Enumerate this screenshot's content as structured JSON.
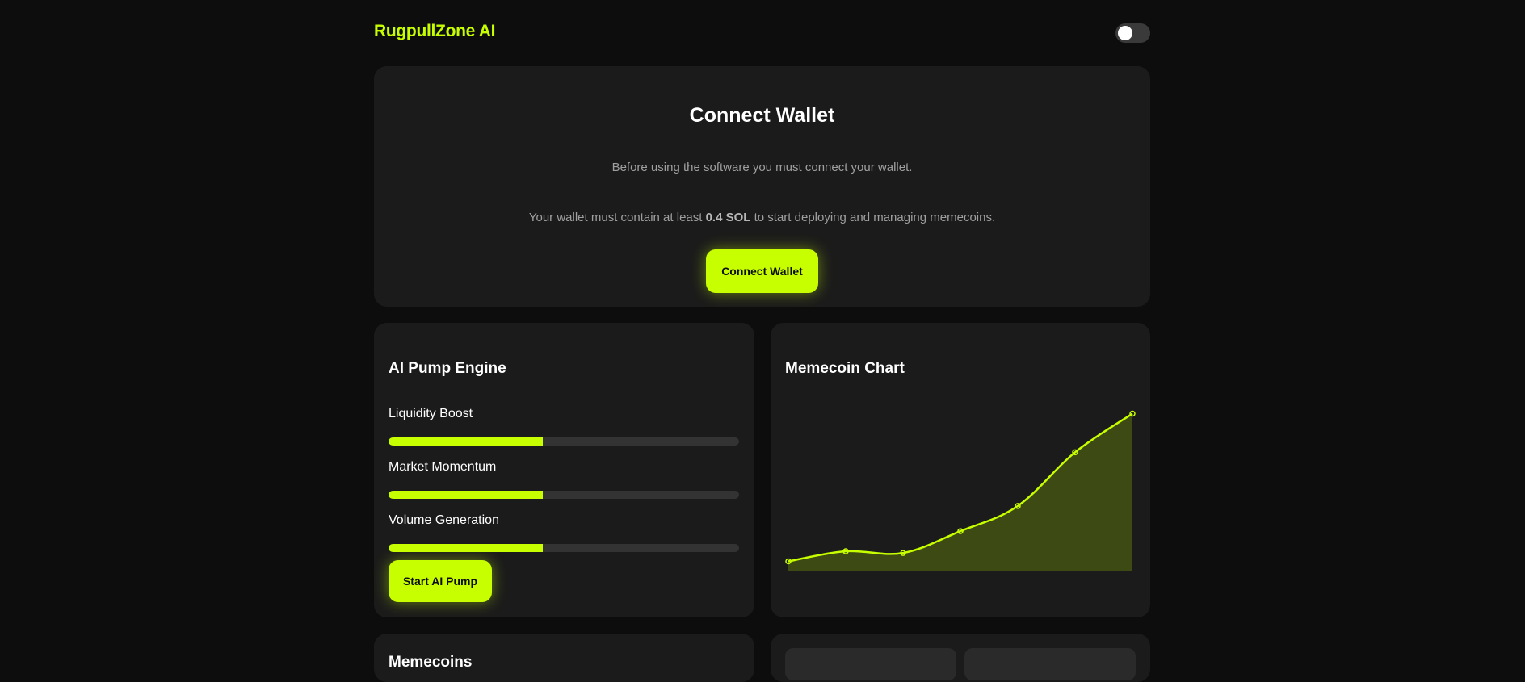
{
  "header": {
    "brand": "RugpullZone AI",
    "theme_toggle": "off"
  },
  "connect": {
    "title": "Connect Wallet",
    "text_1": "Before using the software you must connect your wallet.",
    "text_2_prefix": "Your wallet must contain at least ",
    "text_2_amount": "0.4 SOL",
    "text_2_suffix": " to start deploying and managing memecoins.",
    "button_label": "Connect Wallet"
  },
  "pump": {
    "title": "AI Pump Engine",
    "meters": [
      {
        "label": "Liquidity Boost",
        "value": 0.44
      },
      {
        "label": "Market Momentum",
        "value": 0.44
      },
      {
        "label": "Volume Generation",
        "value": 0.44
      }
    ],
    "button_label": "Start AI Pump"
  },
  "chart": {
    "title": "Memecoin Chart"
  },
  "chart_data": {
    "type": "area",
    "title": "Memecoin Chart",
    "x": [
      0,
      1,
      2,
      3,
      4,
      5,
      6
    ],
    "values": [
      6,
      12,
      11,
      24,
      39,
      71,
      94
    ],
    "ylim": [
      0,
      100
    ],
    "grid": false,
    "legend": "none",
    "line_color": "#c8ff00",
    "fill_color": "#3d4a14"
  },
  "bottom": {
    "left_title": "Memecoins"
  },
  "colors": {
    "accent": "#c8ff00",
    "background": "#0d0d0d",
    "card": "#1b1b1b",
    "track": "#333333"
  }
}
